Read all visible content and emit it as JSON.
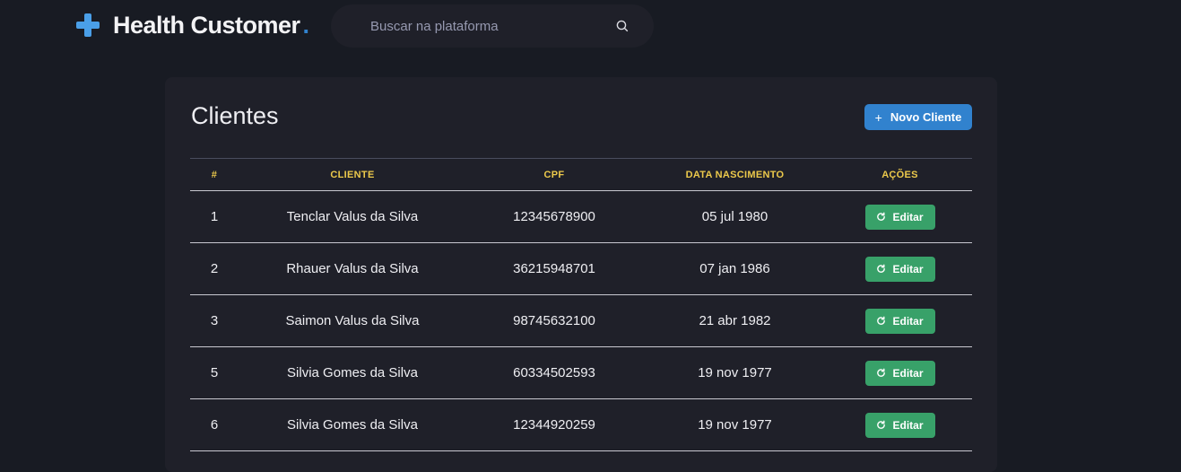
{
  "header": {
    "brand": "Health Customer",
    "brand_dot": ".",
    "search_placeholder": "Buscar na plataforma"
  },
  "clients": {
    "title": "Clientes",
    "new_button": "Novo Cliente",
    "columns": [
      "#",
      "CLIENTE",
      "CPF",
      "DATA NASCIMENTO",
      "AÇÕES"
    ],
    "rows": [
      {
        "id": "1",
        "name": "Tenclar Valus da Silva",
        "cpf": "12345678900",
        "birth": "05 jul 1980",
        "action": "Editar"
      },
      {
        "id": "2",
        "name": "Rhauer Valus da Silva",
        "cpf": "36215948701",
        "birth": "07 jan 1986",
        "action": "Editar"
      },
      {
        "id": "3",
        "name": "Saimon Valus da Silva",
        "cpf": "98745632100",
        "birth": "21 abr 1982",
        "action": "Editar"
      },
      {
        "id": "5",
        "name": "Silvia Gomes da Silva",
        "cpf": "60334502593",
        "birth": "19 nov 1977",
        "action": "Editar"
      },
      {
        "id": "6",
        "name": "Silvia Gomes da Silva",
        "cpf": "12344920259",
        "birth": "19 nov 1977",
        "action": "Editar"
      }
    ]
  },
  "colors": {
    "background": "#181b23",
    "card": "#1f2029",
    "accent_blue": "#3182ce",
    "accent_green": "#38a169",
    "header_yellow": "#ecc94b"
  },
  "icons": {
    "logo": "plus-cross-icon",
    "search": "search-icon",
    "new": "plus-icon",
    "edit": "refresh-icon"
  }
}
